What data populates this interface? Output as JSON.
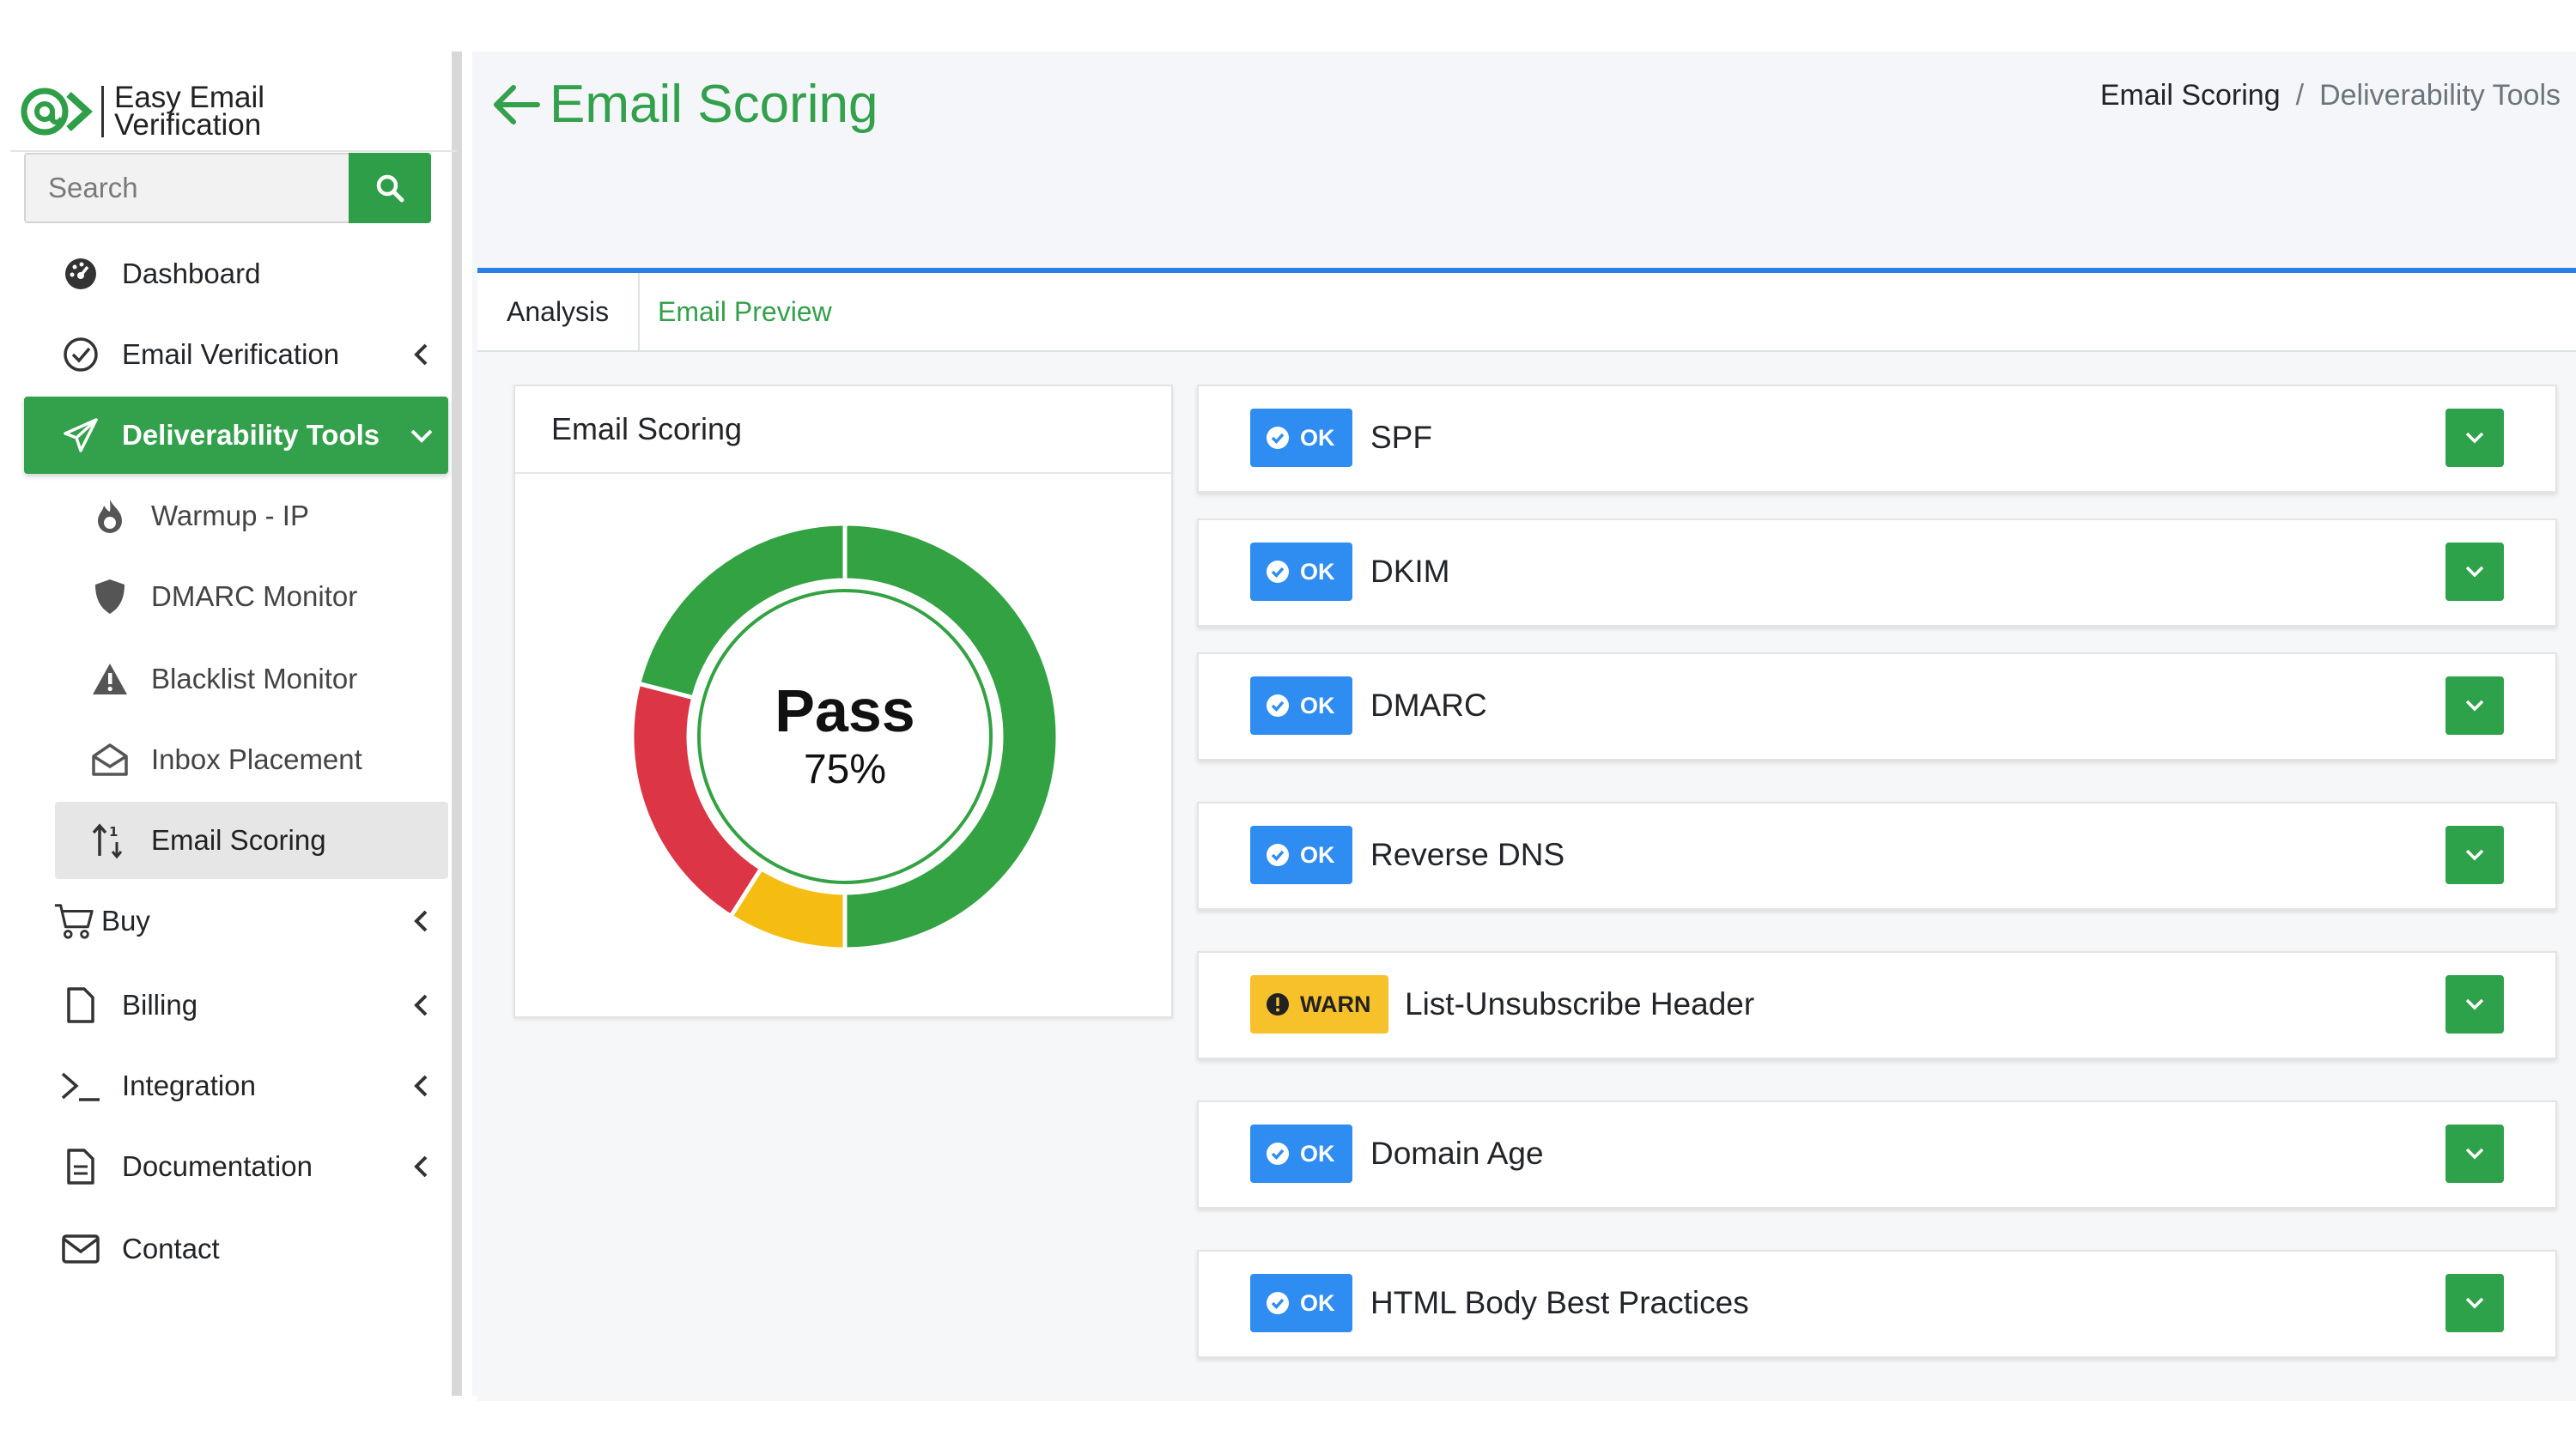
{
  "brand": {
    "line1": "Easy Email",
    "line2": "Verification",
    "color": "#2e9e48"
  },
  "search": {
    "placeholder": "Search"
  },
  "sidebar": {
    "items": [
      {
        "label": "Dashboard",
        "icon": "dashboard-icon"
      },
      {
        "label": "Email Verification",
        "icon": "check-circle-icon"
      },
      {
        "label": "Deliverability Tools",
        "icon": "paper-plane-icon"
      },
      {
        "label": "Warmup - IP",
        "icon": "fire-icon"
      },
      {
        "label": "DMARC Monitor",
        "icon": "shield-icon"
      },
      {
        "label": "Blacklist Monitor",
        "icon": "warning-triangle-icon"
      },
      {
        "label": "Inbox Placement",
        "icon": "envelope-open-icon"
      },
      {
        "label": "Email Scoring",
        "icon": "sort-arrows-icon"
      },
      {
        "label": "Buy",
        "icon": "cart-icon"
      },
      {
        "label": "Billing",
        "icon": "file-icon"
      },
      {
        "label": "Integration",
        "icon": "terminal-icon"
      },
      {
        "label": "Documentation",
        "icon": "document-icon"
      },
      {
        "label": "Contact",
        "icon": "envelope-icon"
      }
    ]
  },
  "header": {
    "title": "Email Scoring",
    "breadcrumb": [
      "Email Scoring",
      "/",
      "Deliverability Tools"
    ]
  },
  "tabs": [
    "Analysis",
    "Email Preview"
  ],
  "score": {
    "title": "Email Scoring",
    "result": "Pass",
    "percent_label": "75%",
    "segments": [
      {
        "name": "green",
        "fraction": 0.5,
        "color": "#33a242"
      },
      {
        "name": "yellow",
        "fraction": 0.09,
        "color": "#f5bc12"
      },
      {
        "name": "red",
        "fraction": 0.2,
        "color": "#dc3545"
      },
      {
        "name": "green-top",
        "fraction": 0.21,
        "color": "#33a242"
      }
    ]
  },
  "checks": [
    {
      "status": "OK",
      "label": "SPF"
    },
    {
      "status": "OK",
      "label": "DKIM"
    },
    {
      "status": "OK",
      "label": "DMARC"
    },
    {
      "status": "OK",
      "label": "Reverse DNS"
    },
    {
      "status": "WARN",
      "label": "List-Unsubscribe Header"
    },
    {
      "status": "OK",
      "label": "Domain Age"
    },
    {
      "status": "OK",
      "label": "HTML Body Best Practices"
    }
  ],
  "colors": {
    "accent": "#33a04b",
    "ok": "#2f8cf0",
    "warn": "#f6c12b",
    "tab_border": "#2a7fe3"
  }
}
